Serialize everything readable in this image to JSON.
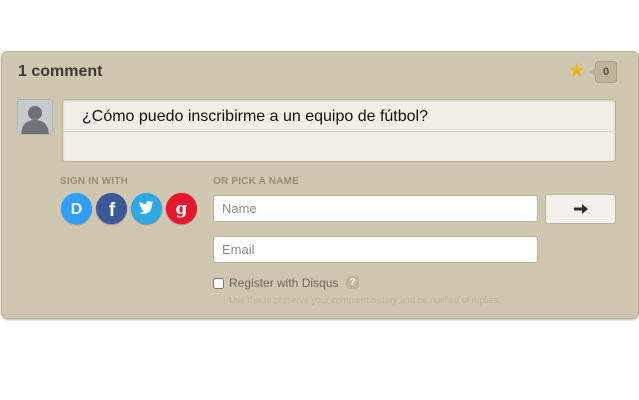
{
  "header": {
    "comment_count": "1 comment",
    "star_count": "0"
  },
  "comment": {
    "text": "¿Cómo puedo inscribirme a un equipo de fútbol?"
  },
  "signin": {
    "label": "SIGN IN WITH",
    "providers": [
      {
        "name": "Disqus",
        "icon": "disqus-icon",
        "color": "#2e9fff"
      },
      {
        "name": "Facebook",
        "icon": "facebook-icon",
        "color": "#3b5998"
      },
      {
        "name": "Twitter",
        "icon": "twitter-icon",
        "color": "#2ea9e6"
      },
      {
        "name": "Google",
        "icon": "google-icon",
        "color": "#e8162a"
      }
    ]
  },
  "guest": {
    "label": "OR PICK A NAME",
    "name_placeholder": "Name",
    "email_placeholder": "Email",
    "register_label": "Register with Disqus",
    "help_label": "?",
    "register_hint": "Use this to preserve your comment history and be notified of replies."
  },
  "colors": {
    "panel": "#d0c7b0",
    "star": "#e9b422"
  }
}
